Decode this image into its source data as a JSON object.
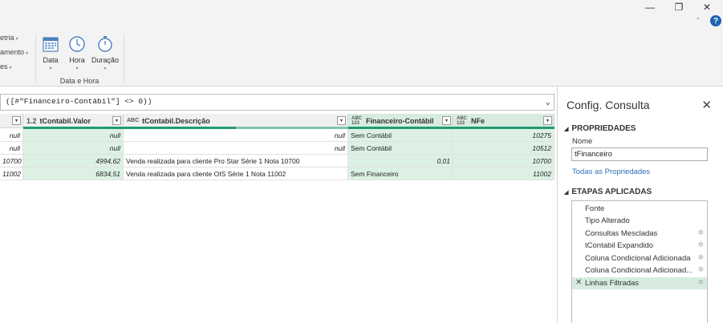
{
  "window": {
    "minimize": "—",
    "restore": "❐",
    "close": "✕",
    "help": "?"
  },
  "ribbon": {
    "small_items": [
      "etria",
      "amento",
      "es"
    ],
    "buttons": [
      {
        "label": "Data",
        "icon": "calendar-icon"
      },
      {
        "label": "Hora",
        "icon": "clock-icon"
      },
      {
        "label": "Duração",
        "icon": "stopwatch-icon"
      }
    ],
    "group_label": "Data e Hora"
  },
  "formula": {
    "text": "([#\"Financeiro-Contábil\"] <> 0))"
  },
  "columns": [
    {
      "type": "",
      "name": ""
    },
    {
      "type": "1.2",
      "name": "tContabil.Valor"
    },
    {
      "type": "ABC",
      "name": "tContabil.Descrição"
    },
    {
      "type": "ABC 123",
      "name": "Financeiro-Contábil"
    },
    {
      "type": "ABC 123",
      "name": "NFe"
    }
  ],
  "rows": [
    [
      "null",
      "null",
      "null",
      "Sem Contábil",
      "10275"
    ],
    [
      "null",
      "null",
      "null",
      "Sem Contábil",
      "10512"
    ],
    [
      "10700",
      "4994,62",
      "Venda realizada para cliente Pro Star Série 1 Nota 10700",
      "0,01",
      "10700"
    ],
    [
      "11002",
      "6834,51",
      "Venda realizada para cliente OIS Série 1 Nota 11002",
      "Sem Financeiro",
      "11002"
    ]
  ],
  "pane": {
    "title": "Config. Consulta",
    "close": "✕",
    "properties_header": "PROPRIEDADES",
    "name_label": "Nome",
    "name_value": "tFinanceiro",
    "all_properties": "Todas as Propriedades",
    "steps_header": "ETAPAS APLICADAS",
    "steps": [
      {
        "label": "Fonte",
        "gear": false
      },
      {
        "label": "Tipo Alterado",
        "gear": false
      },
      {
        "label": "Consultas Mescladas",
        "gear": true
      },
      {
        "label": "tContabil Expandido",
        "gear": true
      },
      {
        "label": "Coluna Condicional Adicionada",
        "gear": true
      },
      {
        "label": "Coluna Condicional Adicionad...",
        "gear": true
      },
      {
        "label": "Linhas Filtradas",
        "gear": true
      }
    ]
  },
  "colors": {
    "accent": "#1f9b74",
    "selected": "#d7ecdf",
    "link": "#2e6fb7"
  }
}
